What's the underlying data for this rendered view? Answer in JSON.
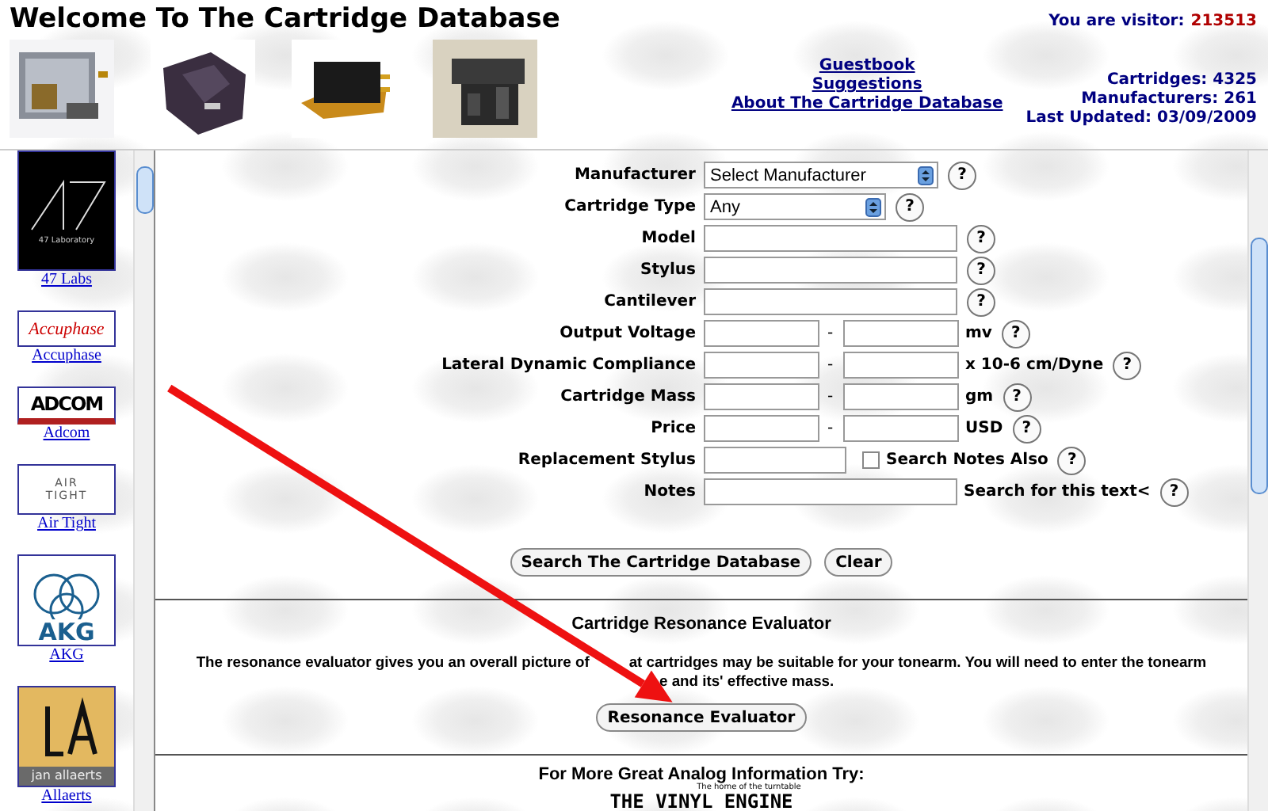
{
  "header": {
    "title": "Welcome To The Cartridge Database",
    "visitor_label": "You are visitor:",
    "visitor_count": "213513",
    "photos": [
      {
        "kind": "picture"
      },
      {
        "kind": "picture"
      },
      {
        "kind": "picture"
      },
      {
        "kind": "picture"
      }
    ],
    "links": [
      "Guestbook",
      "Suggestions",
      "About The Cartridge Database"
    ],
    "stats": [
      "Cartridges: 4325",
      "Manufacturers: 261",
      "Last Updated: 03/09/2009"
    ]
  },
  "sidebar": {
    "items": [
      {
        "name": "47 Labs",
        "logo": "47 Laboratory",
        "kind": "black"
      },
      {
        "name": "Accuphase",
        "logo": "Accuphase",
        "kind": "script"
      },
      {
        "name": "Adcom",
        "logo": "ADCOM",
        "kind": "block"
      },
      {
        "name": "Air Tight",
        "logo": "AIR TIGHT",
        "kind": "thin"
      },
      {
        "name": "AKG",
        "logo": "AKG",
        "kind": "rings"
      },
      {
        "name": "Allaerts",
        "logo": "jan allaerts",
        "kind": "gold"
      }
    ]
  },
  "search_form": {
    "rows": [
      {
        "label": "Manufacturer",
        "kind": "select",
        "value": "Select Manufacturer",
        "help": "?"
      },
      {
        "label": "Cartridge Type",
        "kind": "select",
        "value": "Any",
        "help": "?"
      },
      {
        "label": "Model",
        "kind": "text",
        "help": "?"
      },
      {
        "label": "Stylus",
        "kind": "text",
        "help": "?"
      },
      {
        "label": "Cantilever",
        "kind": "text",
        "help": "?"
      },
      {
        "label": "Output Voltage",
        "kind": "range",
        "separator": "-",
        "unit": "mv",
        "help": "?"
      },
      {
        "label": "Lateral Dynamic Compliance",
        "kind": "range",
        "separator": "-",
        "unit": "x 10-6 cm/Dyne",
        "help": "?"
      },
      {
        "label": "Cartridge Mass",
        "kind": "range",
        "separator": "-",
        "unit": "gm",
        "help": "?"
      },
      {
        "label": "Price",
        "kind": "range",
        "separator": "-",
        "unit": "USD",
        "help": "?"
      },
      {
        "label": "Replacement Stylus",
        "kind": "check",
        "check_label": "Search Notes Also",
        "checked": false,
        "help": "?"
      },
      {
        "label": "Notes",
        "kind": "text",
        "note": "Search for this text<",
        "help": "?"
      }
    ],
    "buttons": [
      "Search The Cartridge Database",
      "Clear"
    ]
  },
  "resonance": {
    "title": "Cartridge Resonance Evaluator",
    "text_parts": [
      "The resonance evaluator gives you an overall picture of",
      "at cartridges may be suitable for your tonearm. You will need to enter the tonearm",
      "e and its' effective mass."
    ],
    "button": "Resonance Evaluator"
  },
  "footer": {
    "text": "For More Great Analog Information Try:",
    "logo": "THE VINYL ENGINE",
    "tagline": "The home of the turntable"
  }
}
